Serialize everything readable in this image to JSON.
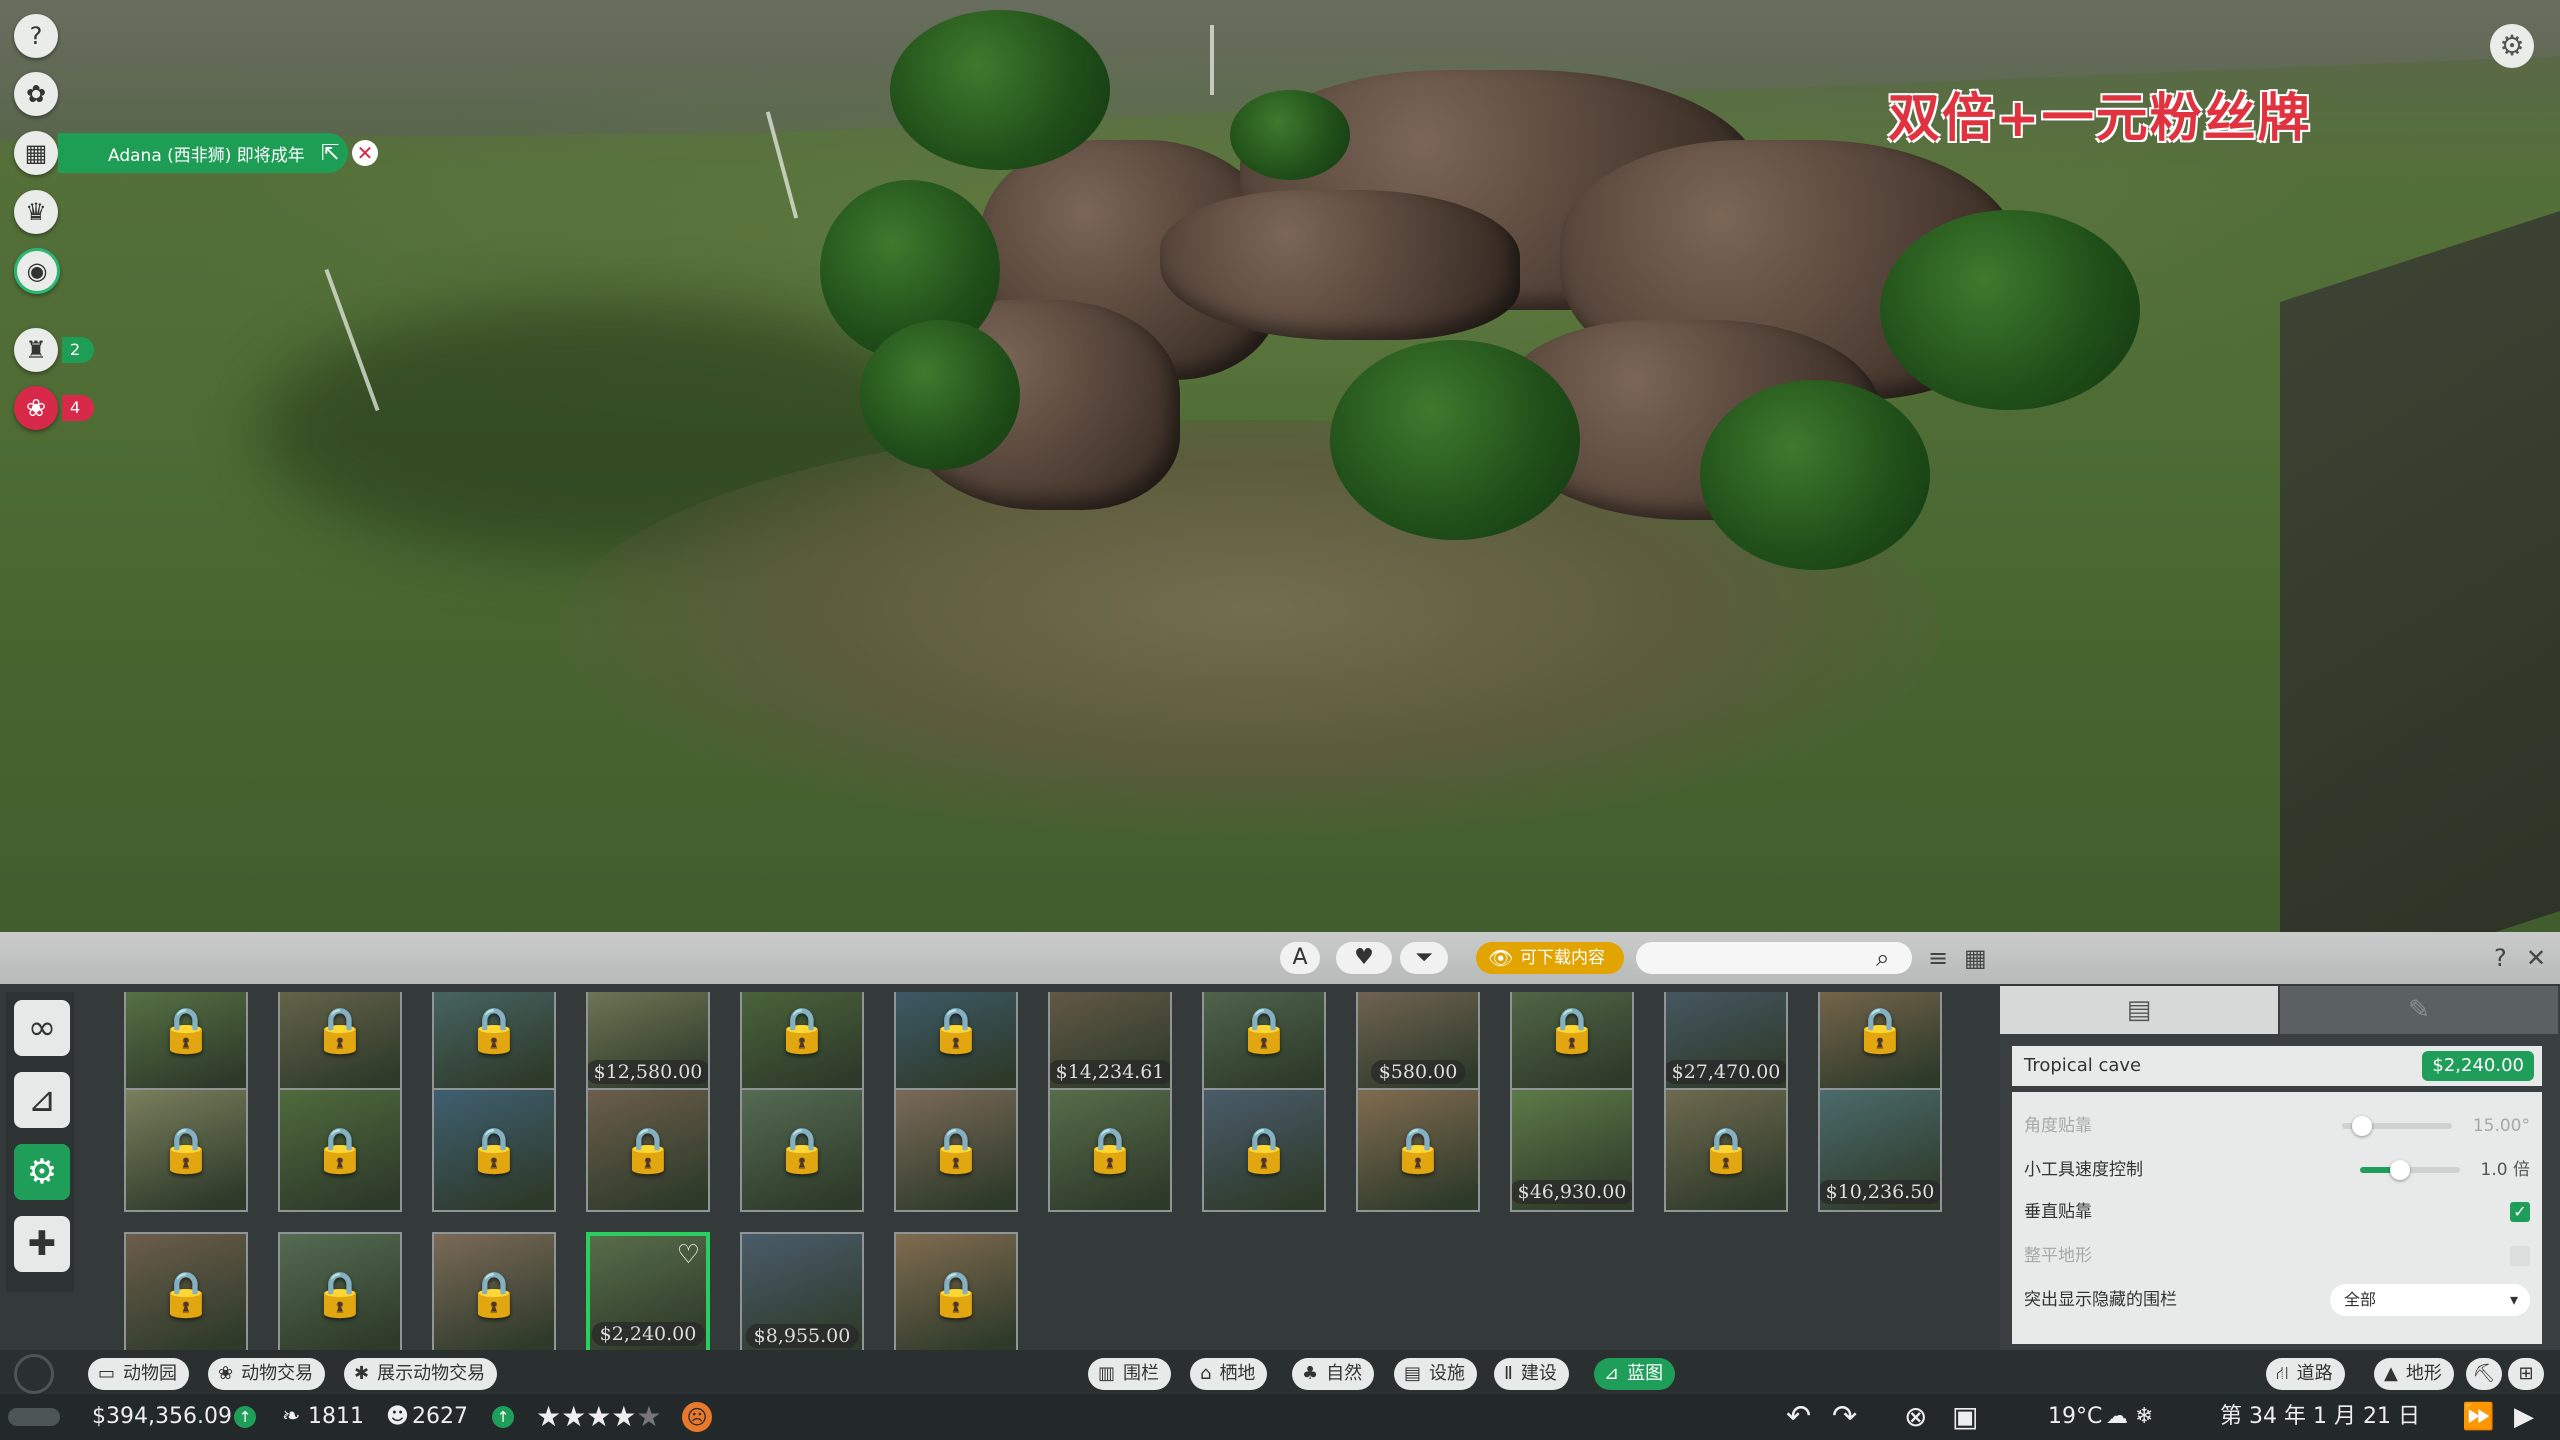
{
  "watermark": "双倍+一元粉丝牌",
  "hud": {
    "notification": {
      "text": "Adana (西非狮) 即将成年"
    },
    "guests_count": "2",
    "animals_count": "4"
  },
  "toolbar": {
    "dlc_label": "可下载内容",
    "search_placeholder": "",
    "help": "?",
    "close": "✕"
  },
  "grid": {
    "row1": [
      {
        "price": "",
        "locked": true
      },
      {
        "price": "",
        "locked": true
      },
      {
        "price": "",
        "locked": true
      },
      {
        "price": "$12,580.00",
        "locked": false
      },
      {
        "price": "",
        "locked": true
      },
      {
        "price": "",
        "locked": true
      },
      {
        "price": "$14,234.61",
        "locked": false
      },
      {
        "price": "",
        "locked": true
      },
      {
        "price": "$580.00",
        "locked": false
      },
      {
        "price": "",
        "locked": true
      },
      {
        "price": "$27,470.00",
        "locked": false
      },
      {
        "price": "",
        "locked": true
      }
    ],
    "row2": [
      {
        "price": "",
        "locked": true
      },
      {
        "price": "",
        "locked": true
      },
      {
        "price": "",
        "locked": true
      },
      {
        "price": "",
        "locked": true
      },
      {
        "price": "",
        "locked": true
      },
      {
        "price": "",
        "locked": true
      },
      {
        "price": "",
        "locked": true
      },
      {
        "price": "",
        "locked": true
      },
      {
        "price": "",
        "locked": true
      },
      {
        "price": "$46,930.00",
        "locked": false
      },
      {
        "price": "",
        "locked": true
      },
      {
        "price": "$10,236.50",
        "locked": false
      }
    ],
    "row3": [
      {
        "price": "",
        "locked": true
      },
      {
        "price": "",
        "locked": true
      },
      {
        "price": "",
        "locked": true
      },
      {
        "price": "$2,240.00",
        "locked": false,
        "selected": true
      },
      {
        "price": "$8,955.00",
        "locked": false
      },
      {
        "price": "",
        "locked": true
      }
    ]
  },
  "info": {
    "title": "Tropical cave",
    "price": "$2,240.00",
    "rows": {
      "angle_snap": {
        "label": "角度贴靠",
        "value": "15.00°"
      },
      "gizmo_speed": {
        "label": "小工具速度控制",
        "value": "1.0 倍"
      },
      "vertical_snap": {
        "label": "垂直贴靠"
      },
      "flatten_terrain": {
        "label": "整平地形"
      },
      "highlight_hidden": {
        "label": "突出显示隐藏的围栏",
        "value": "全部"
      }
    }
  },
  "nav": {
    "left": [
      "动物园",
      "动物交易",
      "展示动物交易"
    ],
    "center": [
      "围栏",
      "栖地",
      "自然",
      "设施",
      "建设",
      "蓝图"
    ],
    "right": [
      "道路",
      "地形"
    ]
  },
  "status": {
    "money": "$394,356.09",
    "conservation": "1811",
    "guests": "2627",
    "temperature": "19°C",
    "date": "第 34 年 1 月 21 日"
  },
  "colors": {
    "accent": "#1f9e59",
    "alert": "#d8294a",
    "dlc": "#e1a400"
  },
  "icons": [
    "help-icon",
    "paw-face-icon",
    "calendar-icon",
    "trophy-icon",
    "eye-icon",
    "keeper-icon",
    "paw-icon",
    "gear-icon"
  ]
}
